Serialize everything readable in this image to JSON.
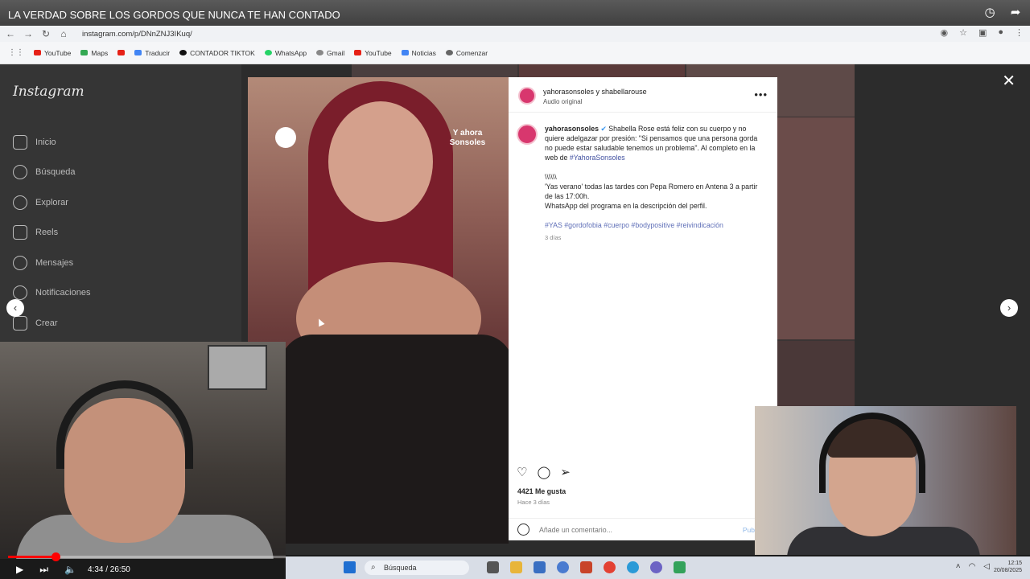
{
  "video": {
    "title": "LA VERDAD SOBRE LOS GORDOS QUE NUNCA TE HAN CONTADO",
    "time": "4:34 / 26:50",
    "progress": 0.17
  },
  "browser": {
    "url": "instagram.com/p/DNnZNJ3IKuq/",
    "bookmarks": [
      {
        "label": "YouTube",
        "color": "#e62117"
      },
      {
        "label": "Maps",
        "color": "#34a853"
      },
      {
        "label": "",
        "color": "#e62117"
      },
      {
        "label": "Traducir",
        "color": "#4285f4"
      },
      {
        "label": "CONTADOR TIKTOK",
        "color": "#111111"
      },
      {
        "label": "WhatsApp",
        "color": "#25d366"
      },
      {
        "label": "Gmail",
        "color": "#888888"
      },
      {
        "label": "YouTube",
        "color": "#e62117"
      },
      {
        "label": "Noticias",
        "color": "#4285f4"
      },
      {
        "label": "Comenzar",
        "color": "#666666"
      }
    ]
  },
  "instagram": {
    "logo": "Instagram",
    "nav": [
      {
        "label": "Inicio",
        "icon": "home-icon"
      },
      {
        "label": "Búsqueda",
        "icon": "search-icon"
      },
      {
        "label": "Explorar",
        "icon": "compass-icon"
      },
      {
        "label": "Reels",
        "icon": "reels-icon"
      },
      {
        "label": "Mensajes",
        "icon": "send-icon"
      },
      {
        "label": "Notificaciones",
        "icon": "heart-icon"
      },
      {
        "label": "Crear",
        "icon": "plus-icon"
      }
    ],
    "post": {
      "header_user": "yahorasonsoles y shabellarouse",
      "audio": "Audio original",
      "image_tag": "Y ahora Sonsoles",
      "caption_user": "yahorasonsoles",
      "caption_p1": "Shabella Rose está feliz con su cuerpo y no quiere adelgazar por presión: \"Si pensamos que una persona gorda no puede estar saludable tenemos un problema\". Al completo en la web de ",
      "caption_p1_link": "#YahoraSonsoles",
      "caption_sep": "\\\\\\\\\\\\",
      "caption_p2": "'Yas verano' todas las tardes con Pepa Romero en Antena 3 a partir de las 17:00h.",
      "caption_p3": "WhatsApp del programa en la descripción del perfil.",
      "hashtags": "#YAS #gordofobia #cuerpo #bodypositive #reivindicación",
      "caption_age": "3 días",
      "likes": "4421 Me gusta",
      "post_age": "Hace 3 días",
      "comment_placeholder": "Añade un comentario...",
      "publish": "Pub"
    }
  },
  "taskbar": {
    "search": "Búsqueda",
    "clock_time": "12:15",
    "clock_date": "20/08/2025"
  }
}
